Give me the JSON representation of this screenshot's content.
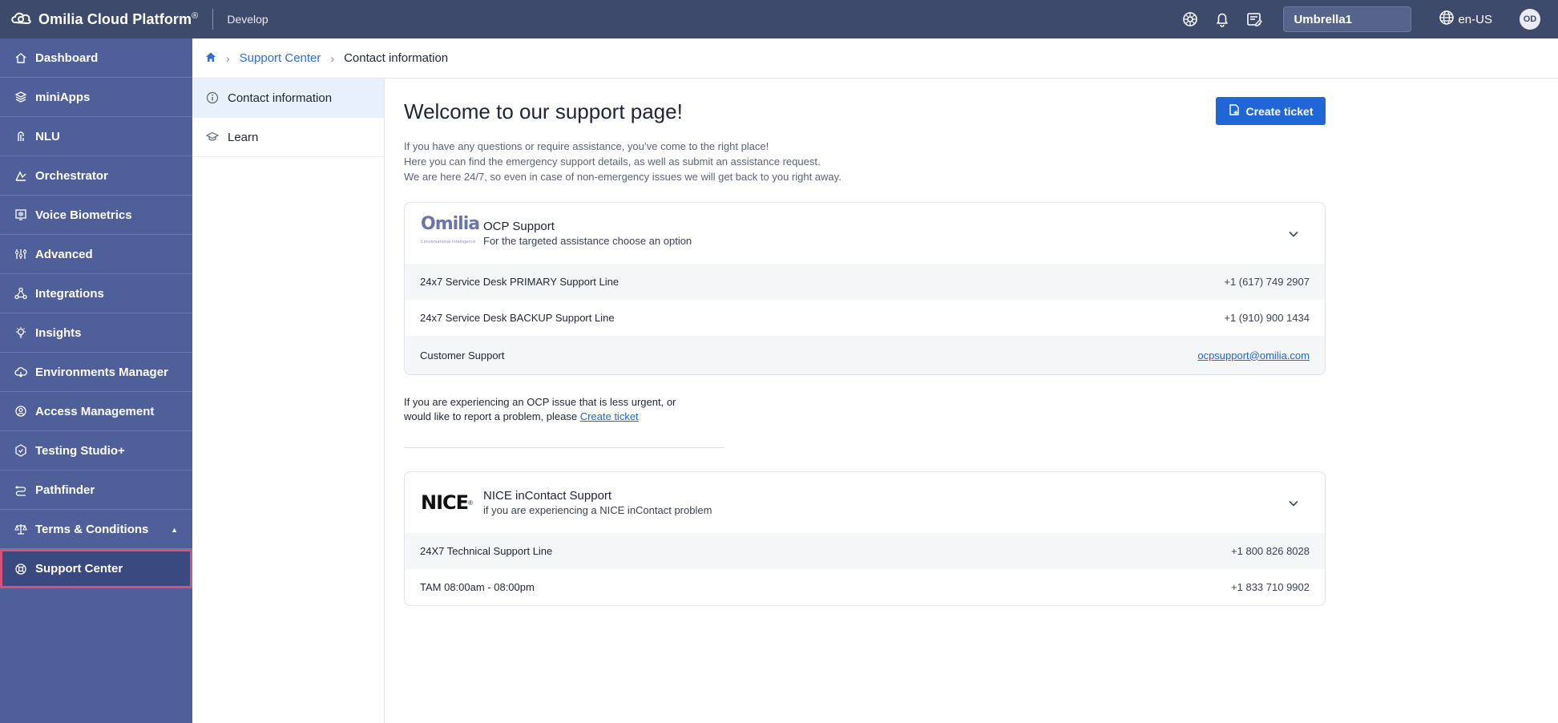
{
  "topbar": {
    "brand": "Omilia Cloud Platform",
    "brand_mark": "®",
    "environment": "Develop",
    "organization": "Umbrella1",
    "language": "en-US",
    "avatar_initials": "OD",
    "icons": [
      "theme-icon",
      "bell-icon",
      "notes-icon",
      "globe-icon"
    ]
  },
  "sidebar": {
    "items": [
      {
        "label": "Dashboard",
        "icon": "home-icon"
      },
      {
        "label": "miniApps",
        "icon": "layers-icon"
      },
      {
        "label": "NLU",
        "icon": "nlu-icon"
      },
      {
        "label": "Orchestrator",
        "icon": "orchestrator-icon"
      },
      {
        "label": "Voice Biometrics",
        "icon": "biometrics-icon"
      },
      {
        "label": "Advanced",
        "icon": "sliders-icon"
      },
      {
        "label": "Integrations",
        "icon": "integrations-icon"
      },
      {
        "label": "Insights",
        "icon": "lightbulb-icon"
      },
      {
        "label": "Environments Manager",
        "icon": "cloud-icon"
      },
      {
        "label": "Access Management",
        "icon": "access-icon"
      },
      {
        "label": "Testing Studio+",
        "icon": "testing-icon"
      },
      {
        "label": "Pathfinder",
        "icon": "pathfinder-icon"
      },
      {
        "label": "Terms & Conditions",
        "icon": "scales-icon",
        "caret": "▲"
      },
      {
        "label": "Support Center",
        "icon": "support-icon"
      }
    ],
    "active": "Support Center"
  },
  "breadcrumb": {
    "home_icon": "home-icon",
    "parent": "Support Center",
    "current": "Contact information"
  },
  "submenu": {
    "items": [
      {
        "label": "Contact information",
        "icon": "info-icon"
      },
      {
        "label": "Learn",
        "icon": "graduation-cap-icon"
      }
    ]
  },
  "main": {
    "title": "Welcome to our support page!",
    "create_ticket_label": "Create ticket",
    "intro": [
      "If you have any questions or require assistance, you’ve come to the right place!",
      "Here you can find the emergency support details, as well as submit an assistance request.",
      "We are here 24/7, so even in case of non-emergency issues we will get back to you right away."
    ],
    "ocp_card": {
      "logo_text": "Omilia",
      "logo_subtext": "Conversational Intelligence",
      "title": "OCP Support",
      "subtitle": "For the targeted assistance choose an option",
      "rows": [
        {
          "label": "24x7 Service Desk PRIMARY Support Line",
          "value": "+1 (617) 749 2907"
        },
        {
          "label": "24x7 Service Desk BACKUP Support Line",
          "value": "+1 (910) 900 1434"
        },
        {
          "label": "Customer Support",
          "value": "ocpsupport@omilia.com"
        }
      ]
    },
    "note": {
      "text_line1": "If you are experiencing an OCP issue that is less urgent, or",
      "text_line2": "would like to report a problem, please ",
      "link": "Create ticket"
    },
    "nice_card": {
      "logo_text": "NICE",
      "logo_mark": "®",
      "title": "NICE inContact Support",
      "subtitle": "if you are experiencing a NICE inContact problem",
      "rows": [
        {
          "label": "24X7 Technical Support Line",
          "value": "+1 800 826 8028"
        },
        {
          "label": "TAM 08:00am - 08:00pm",
          "value": "+1 833 710 9902"
        }
      ]
    }
  },
  "colors": {
    "topbar": "#3e4a6b",
    "sidebar": "#4e5f9a",
    "accent": "#2166d6",
    "active_outline": "#d94f7c"
  }
}
